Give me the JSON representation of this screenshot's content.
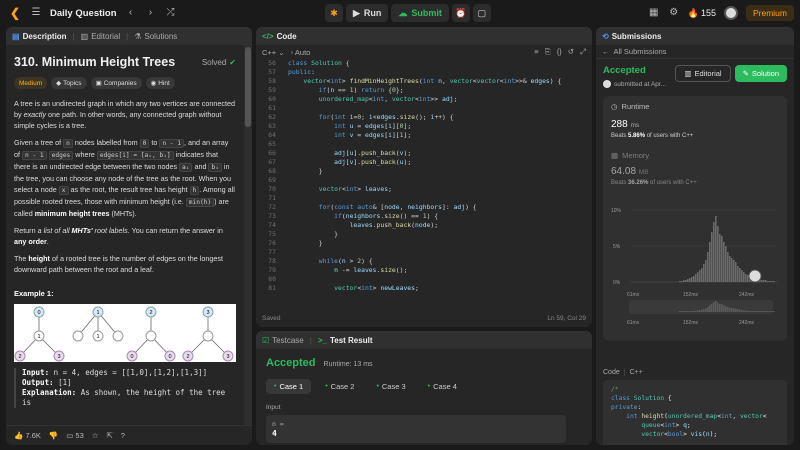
{
  "topbar": {
    "problem_list": "Daily Question",
    "run_label": "Run",
    "submit_label": "Submit",
    "streak": "155",
    "premium": "Premium"
  },
  "desc": {
    "tab_description": "Description",
    "tab_editorial": "Editorial",
    "tab_solutions": "Solutions",
    "title": "310. Minimum Height Trees",
    "solved": "Solved",
    "chip_difficulty": "Medium",
    "chip_topics": "Topics",
    "chip_companies": "Companies",
    "chip_hint": "Hint",
    "p1_a": "A tree is an undirected graph in which any two vertices are connected by ",
    "p1_em": "exactly",
    "p1_b": " one path. In other words, any connected graph without simple cycles is a tree.",
    "p2_a": "Given a tree of ",
    "p2_code1": "n",
    "p2_b": " nodes labelled from ",
    "p2_code2": "0",
    "p2_c": " to ",
    "p2_code3": "n - 1",
    "p2_d": ", and an array of ",
    "p2_code4": "n - 1",
    "p2_code5": "edges",
    "p2_e": " where ",
    "p2_code6": "edges[i] = [aᵢ, bᵢ]",
    "p2_f": " indicates that there is an undirected edge between the two nodes ",
    "p2_code7": "aᵢ",
    "p2_g": " and ",
    "p2_code8": "bᵢ",
    "p2_h": " in the tree, you can choose any node of the tree as the root. When you select a node ",
    "p2_code9": "x",
    "p2_i": " as the root, the result tree has height ",
    "p2_code10": "h",
    "p2_j": ". Among all possible rooted trees, those with minimum height (i.e. ",
    "p2_code11": "min(h)",
    "p2_k": ")  are called ",
    "p2_bold": "minimum height trees",
    "p2_l": " (MHTs).",
    "p3_a": "Return ",
    "p3_em": "a list of all ",
    "p3_bem": "MHTs'",
    "p3_em2": " root labels",
    "p3_b": ". You can return the answer in ",
    "p3_bold": "any order",
    "p3_c": ".",
    "p4_a": "The ",
    "p4_bold": "height",
    "p4_b": " of a rooted tree is the number of edges on the longest downward path between the root and a leaf.",
    "example_title": "Example 1:",
    "ex_input_label": "Input:",
    "ex_input": " n = 4, edges = [[1,0],[1,2],[1,3]]",
    "ex_output_label": "Output:",
    "ex_output": " [1]",
    "ex_expl_label": "Explanation:",
    "ex_expl": " As shown, the height of the tree is",
    "likes": "7.6K",
    "comments": "53",
    "tree_nodes": [
      "0",
      "1",
      "1",
      "2",
      "2",
      "3",
      "3",
      "2",
      "3",
      "0",
      "0",
      "1"
    ]
  },
  "code": {
    "title": "Code",
    "language": "C++",
    "auto": "Auto",
    "status_left": "Saved",
    "status_right": "Ln 59, Col 29",
    "line_numbers": [
      "56",
      "57",
      "58",
      "59",
      "60",
      "61",
      "62",
      "63",
      "64",
      "65",
      "66",
      "67",
      "68",
      "69",
      "70",
      "71",
      "72",
      "73",
      "74",
      "75",
      "76",
      "77",
      "78",
      "79",
      "80",
      "81"
    ]
  },
  "test": {
    "tab_testcase": "Testcase",
    "tab_result": "Test Result",
    "verdict": "Accepted",
    "runtime": "Runtime: 13 ms",
    "case1": "Case 1",
    "case2": "Case 2",
    "case3": "Case 3",
    "case4": "Case 4",
    "input_label": "Input",
    "input_var": "n =",
    "input_val": "4"
  },
  "subs": {
    "tab": "Submissions",
    "back": "All Submissions",
    "verdict": "Accepted",
    "submitted": "submitted at Apr...",
    "editorial": "Editorial",
    "solution": "Solution",
    "runtime_label": "Runtime",
    "runtime_val": "288",
    "runtime_unit": "ms",
    "runtime_beats_a": "Beats ",
    "runtime_beats_b": "5.86%",
    "runtime_beats_c": " of users with C++",
    "memory_label": "Memory",
    "memory_val": "64.08",
    "memory_unit": "MB",
    "memory_beats_a": "Beats ",
    "memory_beats_b": "36.26%",
    "memory_beats_c": " of users with C++",
    "code_label": "Code",
    "code_lang": "C++",
    "hist_y": [
      "10%",
      "5%",
      "0%"
    ],
    "hist_x": [
      "61ms",
      "152ms",
      "242ms"
    ],
    "hist_x2": [
      "61ms",
      "152ms",
      "242ms"
    ]
  },
  "colors": {
    "accent": "#ffa116",
    "green": "#2cbb5d",
    "blue": "#4a8fe7"
  }
}
